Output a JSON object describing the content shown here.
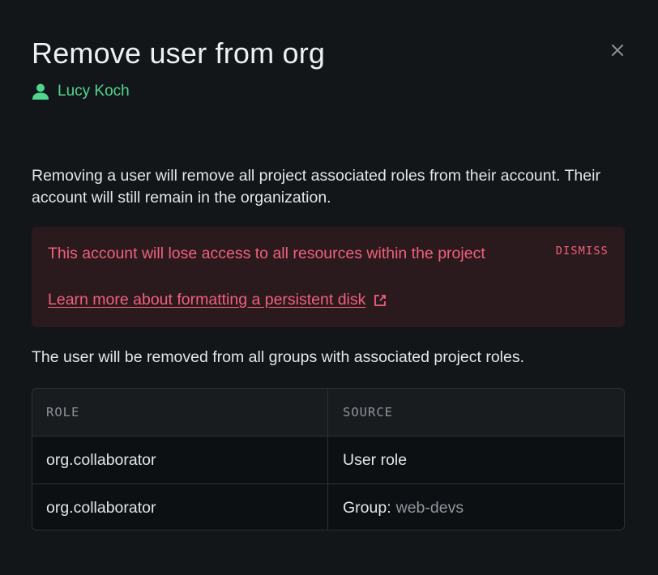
{
  "dialog": {
    "title": "Remove user from org",
    "user_name": "Lucy Koch",
    "description": "Removing a user will remove all project associated roles from their account. Their account will still remain in the organization.",
    "alert": {
      "message": "This account will lose access to all resources within the project",
      "link_text": "Learn more about formatting a persistent disk",
      "dismiss_label": "DISMISS"
    },
    "groups_note": "The user will be removed from all groups with associated project roles.",
    "table": {
      "columns": [
        "ROLE",
        "SOURCE"
      ],
      "rows": [
        {
          "role": "org.collaborator",
          "source_label": "User role",
          "source_value": ""
        },
        {
          "role": "org.collaborator",
          "source_label": "Group:",
          "source_value": "web-devs"
        }
      ]
    }
  },
  "icons": {
    "close": "close-icon",
    "user": "user-icon",
    "external_link": "external-link-icon"
  },
  "colors": {
    "background": "#131619",
    "accent_green": "#4fd68f",
    "alert_red": "#f1607c",
    "alert_background": "#2a1a1d"
  }
}
